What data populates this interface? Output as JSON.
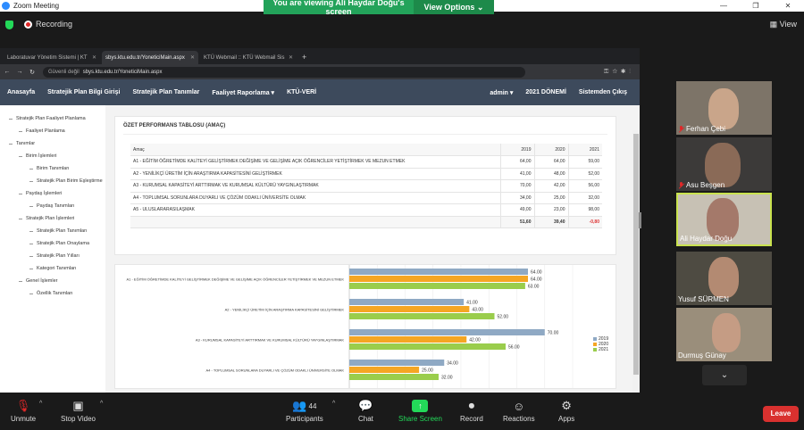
{
  "zoom": {
    "window_title": "Zoom Meeting",
    "recording_label": "Recording",
    "viewing_banner": "You are viewing Ali Haydar Doğu's screen",
    "view_options_label": "View Options",
    "view_label": "View",
    "toolbar": {
      "unmute": "Unmute",
      "stop_video": "Stop Video",
      "participants": "Participants",
      "participants_count": "44",
      "chat": "Chat",
      "share_screen": "Share Screen",
      "record": "Record",
      "reactions": "Reactions",
      "apps": "Apps",
      "leave": "Leave"
    },
    "participants": [
      {
        "name": "Ferhan Çebi",
        "muted": true
      },
      {
        "name": "Asu Beşgen",
        "muted": true
      },
      {
        "name": "Ali Haydar Doğu",
        "muted": false,
        "active": true
      },
      {
        "name": "Yusuf SÜRMEN",
        "muted": false
      },
      {
        "name": "Durmuş Günay",
        "muted": false
      }
    ]
  },
  "browser": {
    "tabs": [
      {
        "label": "Laboratuvar Yönetim Sistemi | KT"
      },
      {
        "label": "sbys.ktu.edu.tr/YoneticiMain.aspx"
      },
      {
        "label": "KTÜ Webmail :: KTÜ Webmail Sis"
      }
    ],
    "insecure_label": "Güvenli değil",
    "url": "sbys.ktu.edu.tr/YoneticiMain.aspx"
  },
  "app": {
    "nav_left": [
      "Anasayfa",
      "Stratejik Plan Bilgi Girişi",
      "Stratejik Plan Tanımlar",
      "Faaliyet Raporlama ▾",
      "KTÜ-VERİ"
    ],
    "nav_right": [
      "admin ▾",
      "2021 DÖNEMİ",
      "Sistemden Çıkış"
    ],
    "tree": [
      {
        "label": "Stratejik Plan Faaliyet Planlama",
        "depth": 0
      },
      {
        "label": "Faaliyet Planlama",
        "depth": 1
      },
      {
        "label": "Tanımlar",
        "depth": 0
      },
      {
        "label": "Birim İşlemleri",
        "depth": 1
      },
      {
        "label": "Birim Tanımları",
        "depth": 2
      },
      {
        "label": "Stratejik Plan Birim Eşleştirme",
        "depth": 2
      },
      {
        "label": "Paydaş İşlemleri",
        "depth": 1
      },
      {
        "label": "Paydaş Tanımları",
        "depth": 2
      },
      {
        "label": "Stratejik Plan İşlemleri",
        "depth": 1
      },
      {
        "label": "Stratejik Plan Tanımları",
        "depth": 2
      },
      {
        "label": "Stratejik Plan Onaylama",
        "depth": 2
      },
      {
        "label": "Stratejik Plan Yılları",
        "depth": 2
      },
      {
        "label": "Kategori Tanımları",
        "depth": 2
      },
      {
        "label": "Genel İşlemler",
        "depth": 1
      },
      {
        "label": "Özellik Tanımları",
        "depth": 2
      }
    ],
    "summary_title": "ÖZET PERFORMANS TABLOSU (AMAÇ)",
    "table": {
      "headers": [
        "Amaç",
        "2019",
        "2020",
        "2021"
      ],
      "rows": [
        [
          "A1 - EĞİTİM ÖĞRETİMDE KALİTEYİ GELİŞTİRMEK DEĞİŞİME VE GELİŞİME AÇIK ÖĞRENCİLER YETİŞTİRMEK VE MEZUN ETMEK",
          "64,00",
          "64,00",
          "59,00"
        ],
        [
          "A2 - YENİLİKÇİ ÜRETİM İÇİN ARAŞTIRMA KAPASİTESİNİ GELİŞTİRMEK",
          "41,00",
          "48,00",
          "52,00"
        ],
        [
          "A3 - KURUMSAL KAPASİTEYİ ARTTIRMAK VE KURUMSAL KÜLTÜRÜ YAYGINLAŞTIRMAK",
          "70,00",
          "42,00",
          "56,00"
        ],
        [
          "A4 - TOPLUMSAL SORUNLARA DUYARLI VE ÇÖZÜM ODAKLI ÜNİVERSİTE OLMAK",
          "34,00",
          "25,00",
          "32,00"
        ],
        [
          "A5 - ULUSLARARASILAŞMAK",
          "49,00",
          "23,00",
          "98,00"
        ]
      ],
      "totals": [
        "",
        "51,60",
        "39,40",
        "-0,80"
      ]
    }
  },
  "chart_data": {
    "type": "bar",
    "orientation": "horizontal",
    "categories": [
      "A1 - EĞİTİM ÖĞRETİMDE KALİTEYİ GELİŞTİRMEK DEĞİŞİME VE GELİŞİME AÇIK ÖĞRENCİLER YETİŞTİRMEK VE MEZUN ETMEK",
      "A2 - YENİLİKÇİ ÜRETİM İÇİN ARAŞTIRMA KAPASİTESİNİ GELİŞTİRMEK",
      "A3 - KURUMSAL KAPASİTEYİ ARTTIRMAK VE KURUMSAL KÜLTÜRÜ YAYGINLAŞTIRMAK",
      "A4 - TOPLUMSAL SORUNLARA DUYARLI VE ÇÖZÜM ODAKLI ÜNİVERSİTE OLMAK",
      ""
    ],
    "series": [
      {
        "name": "2019",
        "color": "#8fa9c4",
        "values": [
          64,
          41,
          70,
          34,
          49
        ],
        "labels": [
          "64.00",
          "41.00",
          "70.00",
          "34.00",
          "49.00"
        ]
      },
      {
        "name": "2020",
        "color": "#f5a623",
        "values": [
          64,
          43,
          42,
          25,
          null
        ],
        "labels": [
          "64.00",
          "43.00",
          "42.00",
          "25.00",
          ""
        ]
      },
      {
        "name": "2021",
        "color": "#9acd4c",
        "values": [
          63,
          52,
          56,
          32,
          null
        ],
        "labels": [
          "63.00",
          "52.00",
          "56.00",
          "32.00",
          ""
        ]
      }
    ],
    "xlim": [
      0,
      80
    ],
    "legend": "right",
    "grid": true
  }
}
